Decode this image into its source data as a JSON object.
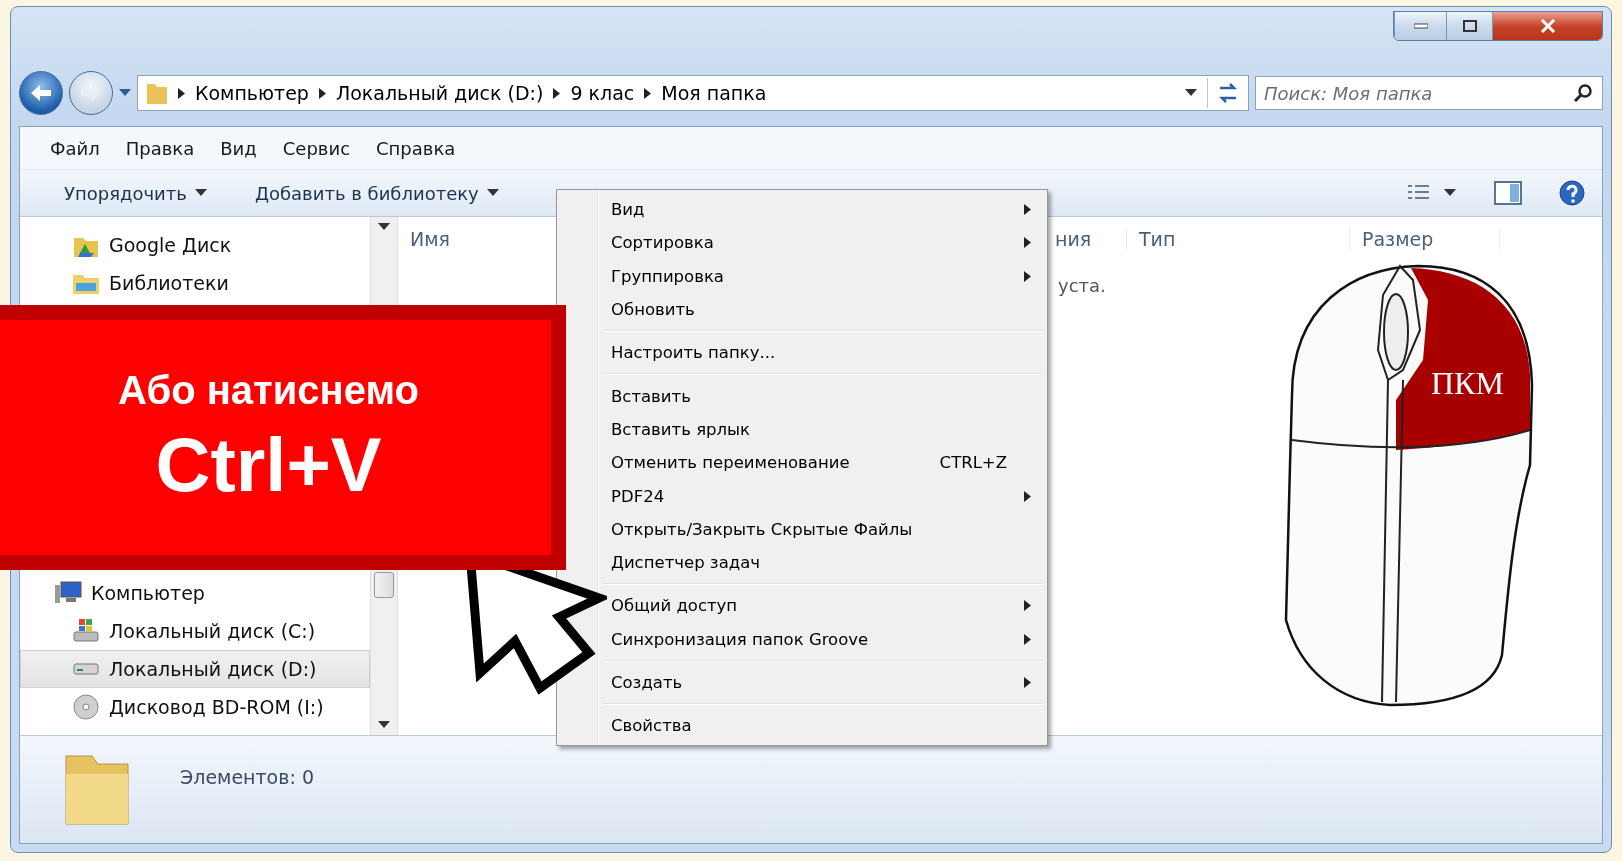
{
  "address_bar": {
    "breadcrumbs": [
      "Компьютер",
      "Локальный диск (D:)",
      "9 клас",
      "Моя папка"
    ]
  },
  "search": {
    "placeholder": "Поиск: Моя папка"
  },
  "menu_bar": [
    "Файл",
    "Правка",
    "Вид",
    "Сервис",
    "Справка"
  ],
  "toolbar": [
    "Упорядочить",
    "Добавить в библиотеку"
  ],
  "nav_pane": {
    "top_items": [
      {
        "label": "Google Диск",
        "kind": "cloud",
        "selected": false
      },
      {
        "label": "Библиотеки",
        "kind": "library",
        "selected": false
      }
    ],
    "tree": [
      {
        "label": "Компьютер",
        "kind": "computer",
        "selected": false,
        "children": [
          {
            "label": "Локальный диск (C:)",
            "kind": "system-disk",
            "selected": false
          },
          {
            "label": "Локальный диск (D:)",
            "kind": "disk",
            "selected": true
          },
          {
            "label": "Дисковод BD-ROM (I:)",
            "kind": "optical",
            "selected": false
          }
        ]
      }
    ]
  },
  "columns": [
    "Имя",
    "ния",
    "Тип",
    "Размер"
  ],
  "empty_message": "уста.",
  "status_bar": {
    "text": "Элементов: 0"
  },
  "context_menu": [
    [
      {
        "label": "Вид",
        "submenu": true
      },
      {
        "label": "Сортировка",
        "submenu": true
      },
      {
        "label": "Группировка",
        "submenu": true
      },
      {
        "label": "Обновить",
        "submenu": false
      }
    ],
    [
      {
        "label": "Настроить папку...",
        "submenu": false
      }
    ],
    [
      {
        "label": "Вставить",
        "submenu": false
      },
      {
        "label": "Вставить ярлык",
        "submenu": false
      },
      {
        "label": "Отменить переименование",
        "submenu": false,
        "shortcut": "CTRL+Z"
      },
      {
        "label": "PDF24",
        "submenu": true
      },
      {
        "label": "Открыть/Закрыть Скрытые Файлы",
        "submenu": false
      },
      {
        "label": "Диспетчер задач",
        "submenu": false
      }
    ],
    [
      {
        "label": "Общий доступ",
        "submenu": true
      },
      {
        "label": "Синхронизация папок Groove",
        "submenu": true
      }
    ],
    [
      {
        "label": "Создать",
        "submenu": true
      }
    ],
    [
      {
        "label": "Свойства",
        "submenu": false
      }
    ]
  ],
  "banner": {
    "line1": "Або натиснемо",
    "line2": "Ctrl+V"
  },
  "mouse_label": "ПКМ"
}
